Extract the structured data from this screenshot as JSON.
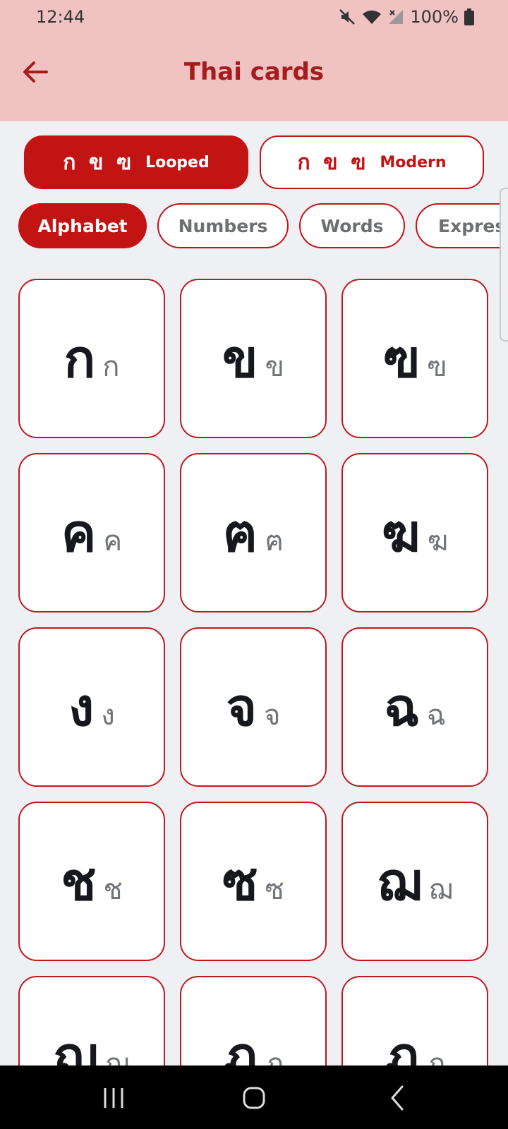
{
  "status_bar": {
    "time": "12:44",
    "battery": "100%",
    "icons": [
      "mute-icon",
      "wifi-icon",
      "no-signal-icon",
      "battery-icon"
    ]
  },
  "app_bar": {
    "title": "Thai cards",
    "back_icon": "arrow-left-icon"
  },
  "style_toggle": [
    {
      "glyphs": "ก ข ฃ",
      "label": "Looped",
      "selected": true
    },
    {
      "glyphs": "ก ข ฃ",
      "label": "Modern",
      "selected": false
    }
  ],
  "categories": [
    {
      "label": "Alphabet",
      "selected": true
    },
    {
      "label": "Numbers",
      "selected": false
    },
    {
      "label": "Words",
      "selected": false
    },
    {
      "label": "Expressions",
      "selected": false
    }
  ],
  "cards": [
    {
      "looped": "ก",
      "modern": "ก"
    },
    {
      "looped": "ข",
      "modern": "ข"
    },
    {
      "looped": "ฃ",
      "modern": "ฃ"
    },
    {
      "looped": "ค",
      "modern": "ค"
    },
    {
      "looped": "ฅ",
      "modern": "ฅ"
    },
    {
      "looped": "ฆ",
      "modern": "ฆ"
    },
    {
      "looped": "ง",
      "modern": "ง"
    },
    {
      "looped": "จ",
      "modern": "จ"
    },
    {
      "looped": "ฉ",
      "modern": "ฉ"
    },
    {
      "looped": "ช",
      "modern": "ช"
    },
    {
      "looped": "ซ",
      "modern": "ซ"
    },
    {
      "looped": "ฌ",
      "modern": "ฌ"
    },
    {
      "looped": "ญ",
      "modern": "ญ"
    },
    {
      "looped": "ฎ",
      "modern": "ฎ"
    },
    {
      "looped": "ฏ",
      "modern": "ฏ"
    }
  ],
  "colors": {
    "accent": "#c31414",
    "header_bg": "#f0c2c2",
    "title": "#a51c1c",
    "page_bg": "#eef0f4"
  },
  "nav_bar": {
    "buttons": [
      "recent-apps-icon",
      "home-icon",
      "back-icon"
    ]
  }
}
